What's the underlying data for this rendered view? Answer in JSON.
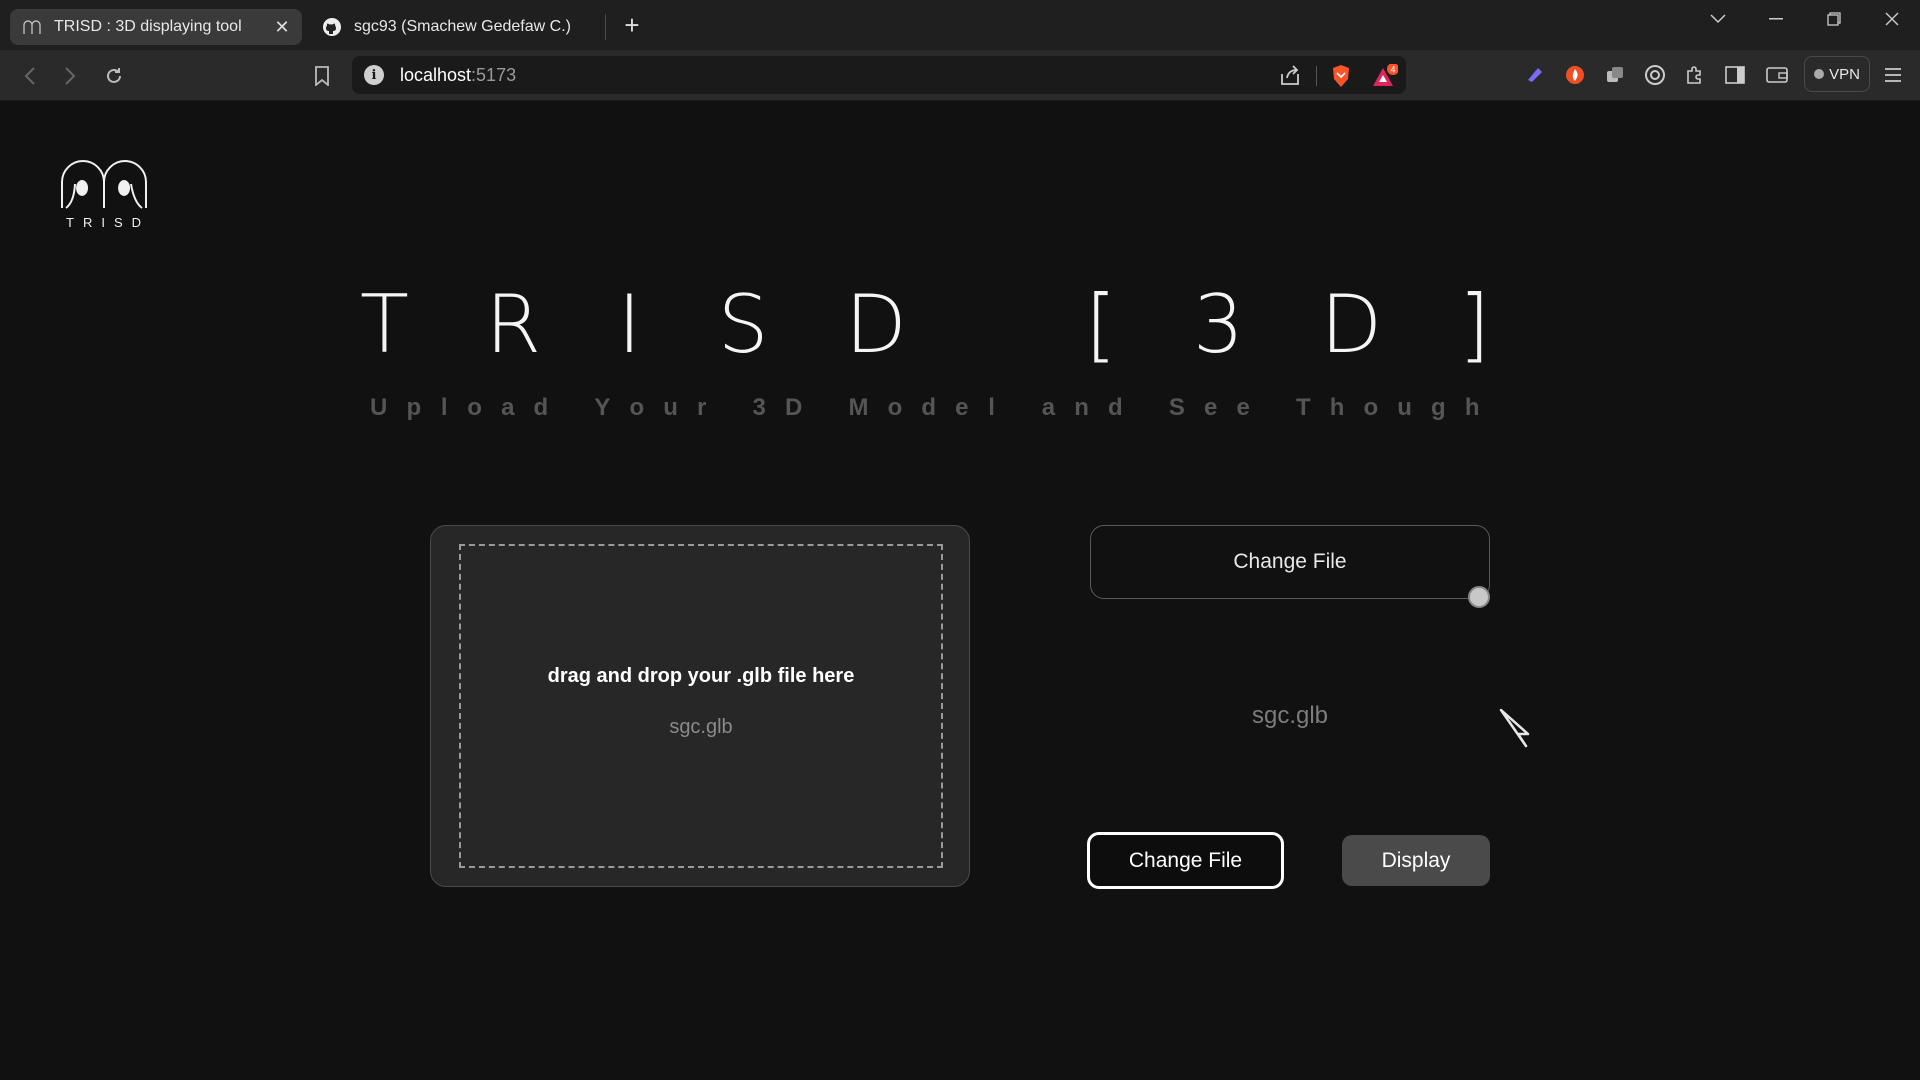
{
  "browser": {
    "tabs": [
      {
        "title": "TRISD : 3D displaying tool",
        "active": true
      },
      {
        "title": "sgc93 (Smachew Gedefaw C.)",
        "active": false
      }
    ],
    "new_tab_label": "+",
    "url_host": "localhost",
    "url_port": ":5173",
    "notification_count": "4",
    "vpn_label": "VPN"
  },
  "logo": {
    "text": "TRISD"
  },
  "hero": {
    "title_chars": [
      "T",
      "R",
      "I",
      "S",
      "D",
      "",
      "[",
      "3",
      "D",
      "]"
    ],
    "subtitle_chars": [
      "U",
      "p",
      "l",
      "o",
      "a",
      "d",
      "",
      "Y",
      "o",
      "u",
      "r",
      "",
      "3",
      "D",
      "",
      "M",
      "o",
      "d",
      "e",
      "l",
      "",
      "a",
      "n",
      "d",
      "",
      "S",
      "e",
      "e",
      "",
      "T",
      "h",
      "o",
      "u",
      "g",
      "h"
    ]
  },
  "dropzone": {
    "instruction": "drag and drop your .glb file here",
    "filename": "sgc.glb"
  },
  "right_panel": {
    "change_file_top": "Change File",
    "filename": "sgc.glb",
    "change_file_button": "Change File",
    "display_button": "Display"
  },
  "colors": {
    "background": "#111111",
    "dropzone": "#272727",
    "display_button": "#4a4a4a"
  }
}
